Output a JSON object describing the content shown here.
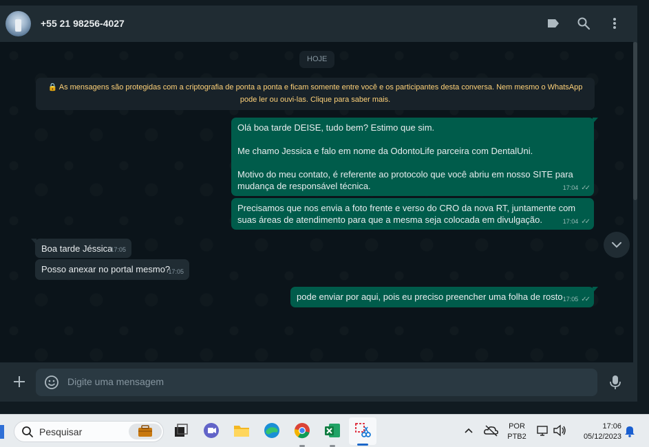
{
  "header": {
    "contact_name": "+55 21 98256-4027",
    "icons": [
      "label-icon",
      "search-icon",
      "menu-icon"
    ]
  },
  "chat": {
    "date_chip": "HOJE",
    "encryption_notice": "🔒 As mensagens são protegidas com a criptografia de ponta a ponta e ficam somente entre você e os participantes desta conversa. Nem mesmo o WhatsApp pode ler ou ouvi-las. Clique para saber mais.",
    "messages": [
      {
        "dir": "out",
        "lines": [
          "Olá boa tarde DEISE, tudo bem? Estimo que sim.",
          "",
          "Me chamo Jessica e falo em nome da OdontoLife parceira com DentalUni.",
          "",
          "Motivo do meu contato, é referente ao protocolo que você abriu em nosso SITE para mudança de responsável técnica."
        ],
        "time": "17:04"
      },
      {
        "dir": "out",
        "lines": [
          "Precisamos que nos envia a foto frente e verso do CRO da nova RT, juntamente com suas áreas de atendimento para que a mesma seja colocada em divulgação."
        ],
        "time": "17:04"
      },
      {
        "dir": "in",
        "lines": [
          "Boa tarde Jéssica"
        ],
        "time": "17:05"
      },
      {
        "dir": "in",
        "lines": [
          "Posso anexar no portal mesmo?"
        ],
        "time": "17:05"
      },
      {
        "dir": "out",
        "lines": [
          "pode enviar por aqui, pois eu preciso preencher uma folha de rosto"
        ],
        "time": "17:05"
      }
    ]
  },
  "composer": {
    "placeholder": "Digite uma mensagem"
  },
  "taskbar": {
    "search_label": "Pesquisar",
    "language_line1": "POR",
    "language_line2": "PTB2",
    "clock_time": "17:06",
    "clock_date": "05/12/2023"
  },
  "colors": {
    "outgoing_bubble": "#005c4b",
    "incoming_bubble": "#202c33",
    "chat_background": "#0b141a",
    "header": "#202c33",
    "encryption_text": "#ffd279"
  }
}
